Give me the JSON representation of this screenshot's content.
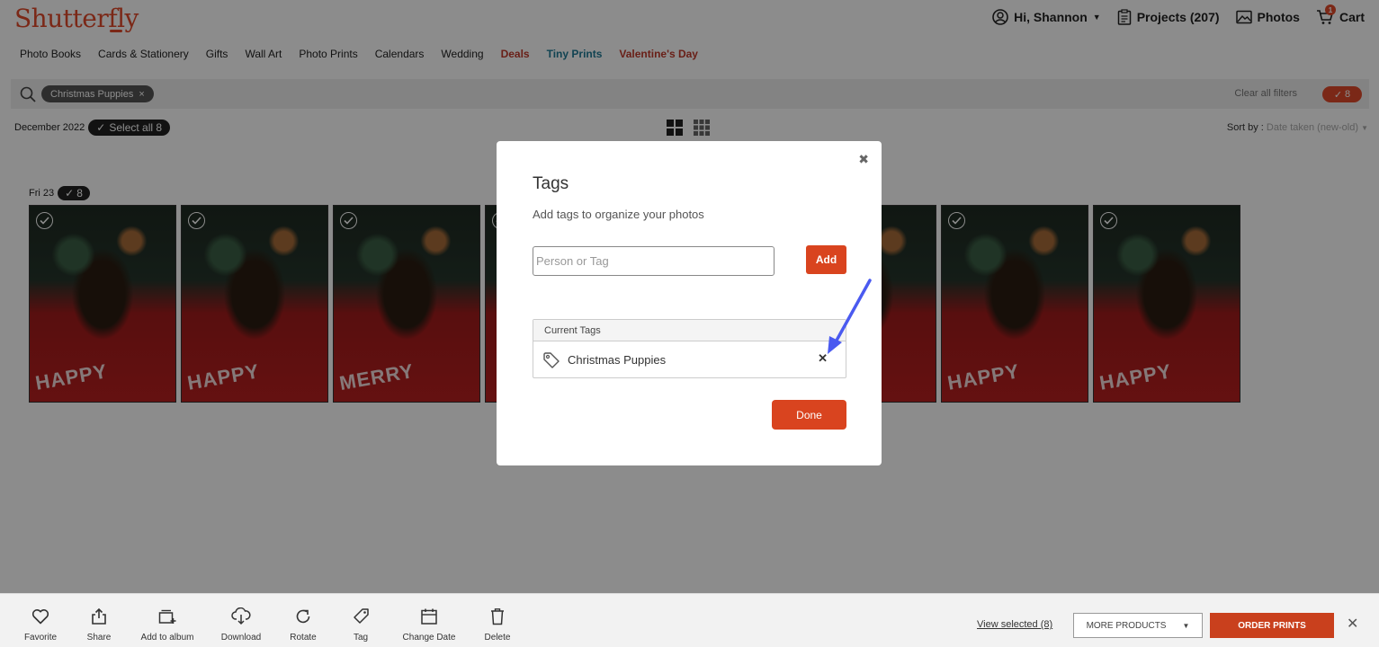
{
  "header": {
    "logo": "Shutterfly",
    "user": "Hi, Shannon",
    "projects": "Projects (207)",
    "photos": "Photos",
    "cart": "Cart",
    "cart_count": "1"
  },
  "nav": [
    "Photo Books",
    "Cards & Stationery",
    "Gifts",
    "Wall Art",
    "Photo Prints",
    "Calendars",
    "Wedding",
    "Deals",
    "Tiny Prints",
    "Valentine's Day"
  ],
  "filter": {
    "chip": "Christmas Puppies",
    "clear_all": "Clear all filters",
    "selected_count": "8"
  },
  "gallery": {
    "month": "December 2022",
    "select_all": "Select all 8",
    "sort_label": "Sort by :",
    "sort_value": "Date taken (new-old)",
    "day": "Fri 23",
    "day_count": "8"
  },
  "modal": {
    "title": "Tags",
    "subtitle": "Add tags to organize your photos",
    "input_placeholder": "Person or Tag",
    "add_label": "Add",
    "current_tags_header": "Current Tags",
    "tag": "Christmas Puppies",
    "done_label": "Done"
  },
  "toolbar": {
    "favorite": "Favorite",
    "share": "Share",
    "add_to_album": "Add to album",
    "download": "Download",
    "rotate": "Rotate",
    "tag": "Tag",
    "change_date": "Change Date",
    "delete": "Delete",
    "view_selected": "View selected (8)",
    "more_products": "MORE PRODUCTS",
    "order_prints": "ORDER PRINTS"
  },
  "colors": {
    "brand": "#e04a2b",
    "annotation_arrow": "#4a5af0"
  }
}
